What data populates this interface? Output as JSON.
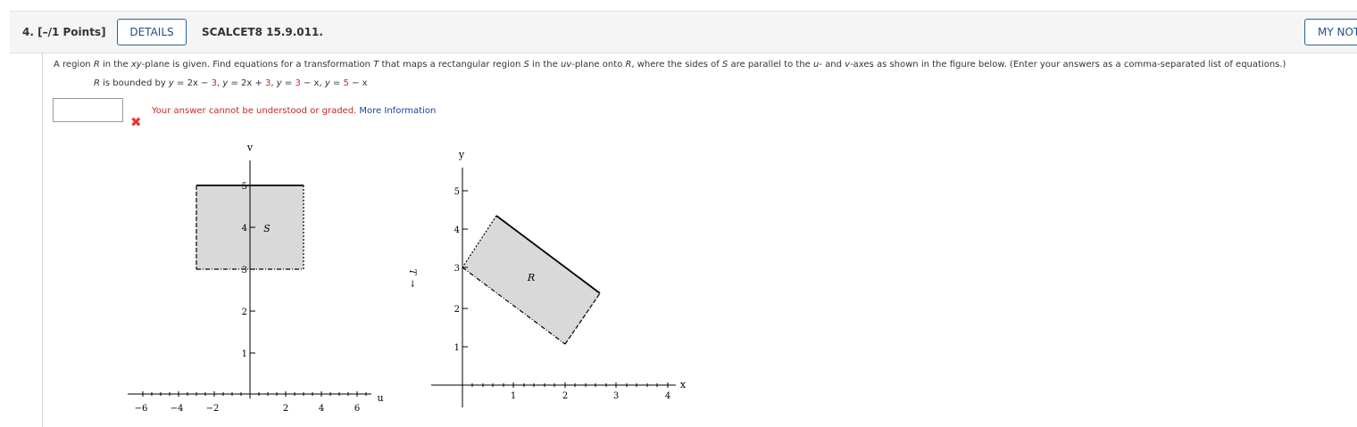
{
  "header": {
    "question_number": "4.",
    "points": "[–/1 Points]",
    "details_label": "DETAILS",
    "question_id": "SCALCET8 15.9.011.",
    "notes_label": "MY NOTES"
  },
  "question": {
    "prompt_parts": {
      "a": "A region ",
      "R": "R",
      "b": " in the ",
      "xy": "xy",
      "c": "-plane is given. Find equations for a transformation ",
      "T": "T",
      "d": " that maps a rectangular region ",
      "S": "S",
      "e": " in the ",
      "uv": "uv",
      "f": "-plane onto ",
      "R2": "R",
      "g": ", where the sides of ",
      "S2": "S",
      "h": " are parallel to the ",
      "u": "u",
      "i": "- and ",
      "v": "v",
      "j": "-axes as shown in the figure below. (Enter your answers as a comma-separated list of equations.)"
    },
    "bounds_parts": {
      "R": "R",
      "is_bounded_by": " is bounded by ",
      "y1": "y",
      "eq1": " = 2x − ",
      "c1": "3",
      "sep1": ", ",
      "y2": "y",
      "eq2": " = 2x + ",
      "c2": "3",
      "sep2": ", ",
      "y3": "y",
      "eq3": " = ",
      "c3": "3",
      "eq3b": " − x, ",
      "y4": "y",
      "eq4": " = ",
      "c4": "5",
      "eq4b": " − x"
    }
  },
  "answer": {
    "value": "",
    "placeholder": "",
    "status_icon": "x-mark-icon",
    "error_message": "Your answer cannot be understood or graded.",
    "more_info_link": "More Information"
  },
  "figure": {
    "uv_plot": {
      "x_axis_label": "u",
      "y_axis_label": "v",
      "region_label": "S",
      "x_tick_labels": [
        "−6",
        "−4",
        "−2",
        "2",
        "4",
        "6"
      ],
      "y_tick_labels": [
        "1",
        "2",
        "3",
        "4",
        "5"
      ],
      "rectangle": {
        "u_range": [
          -3,
          3
        ],
        "v_range": [
          3,
          5
        ]
      }
    },
    "transform_label": "T",
    "arrow_glyph": "→",
    "xy_plot": {
      "x_axis_label": "x",
      "y_axis_label": "y",
      "region_label": "R",
      "x_tick_labels": [
        "1",
        "2",
        "3",
        "4"
      ],
      "y_tick_labels": [
        "1",
        "2",
        "3",
        "4",
        "5"
      ],
      "vertices": [
        [
          0,
          3
        ],
        [
          2,
          1
        ],
        [
          2.67,
          2.33
        ],
        [
          0.67,
          4.33
        ]
      ]
    }
  },
  "colors": {
    "region_fill": "#d9d9d9",
    "error_red": "#c62828",
    "link_blue": "#1a3ea8",
    "button_border": "#2a6496"
  }
}
